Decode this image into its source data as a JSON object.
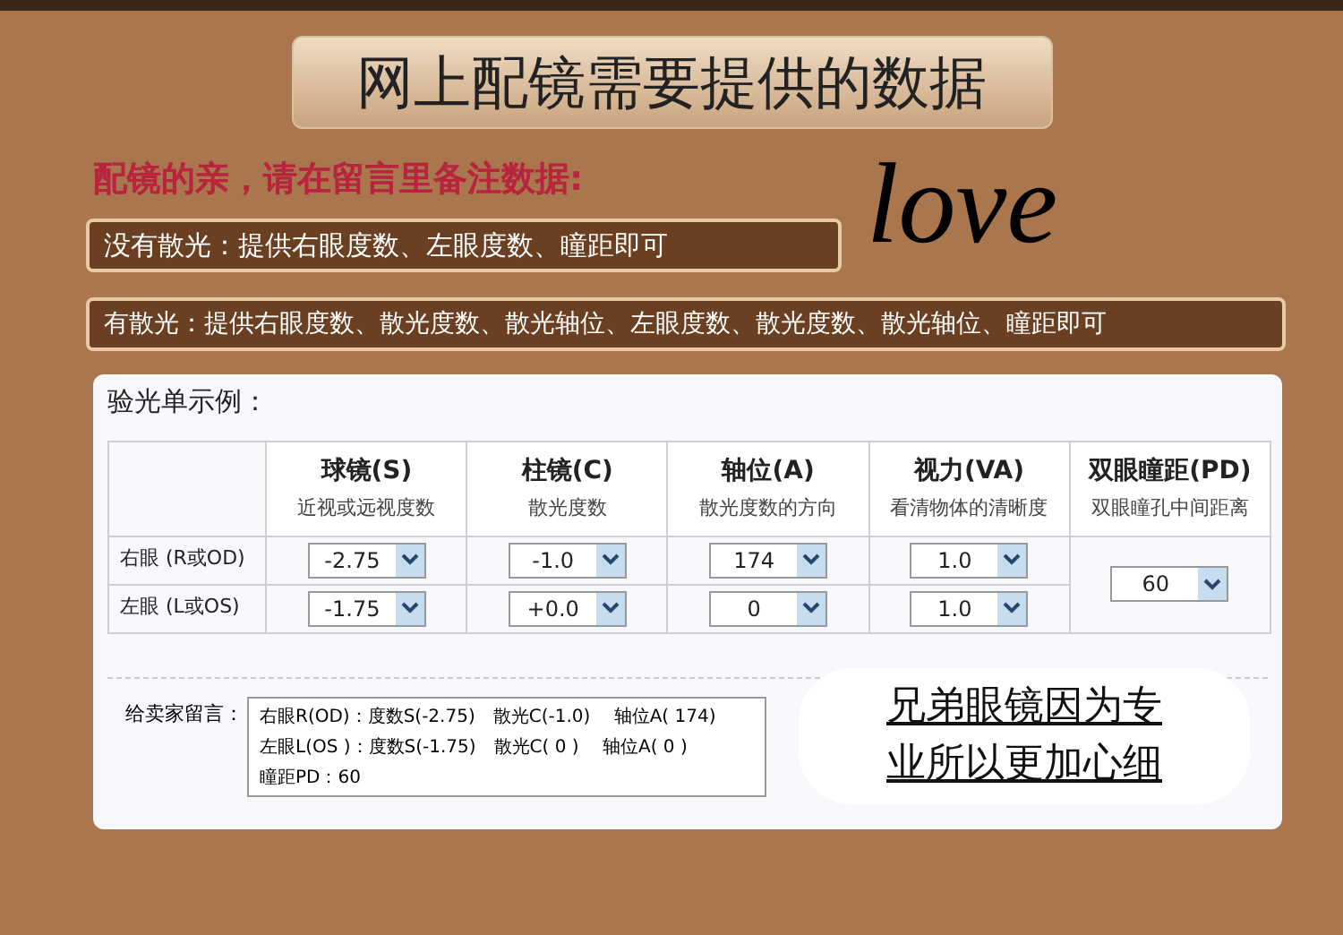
{
  "title": "网上配镜需要提供的数据",
  "subtitle": "配镜的亲，请在留言里备注数据:",
  "notes": [
    "没有散光：提供右眼度数、左眼度数、瞳距即可",
    "有散光：提供右眼度数、散光度数、散光轴位、左眼度数、散光度数、散光轴位、瞳距即可"
  ],
  "signature": "love",
  "form": {
    "heading": "验光单示例：",
    "columns": [
      {
        "name": "球镜(S)",
        "hint": "近视或远视度数"
      },
      {
        "name": "柱镜(C)",
        "hint": "散光度数"
      },
      {
        "name": "轴位(A)",
        "hint": "散光度数的方向"
      },
      {
        "name": "视力(VA)",
        "hint": "看清物体的清晰度"
      },
      {
        "name": "双眼瞳距(PD)",
        "hint": "双眼瞳孔中间距离"
      }
    ],
    "rows": [
      {
        "label": "右眼 (R或OD)",
        "values": [
          "-2.75",
          "-1.0",
          "174",
          "1.0"
        ]
      },
      {
        "label": "左眼 (L或OS)",
        "values": [
          "-1.75",
          "+0.0",
          "0",
          "1.0"
        ]
      }
    ],
    "pd": "60",
    "message_label": "给卖家留言：",
    "message_lines": [
      "右眼R(OD)：度数S(-2.75)　散光C(-1.0)　 轴位A( 174)",
      "左眼L(OS )：度数S(-1.75)　散光C( 0 )　 轴位A( 0 )",
      "瞳距PD：60"
    ],
    "slogan": [
      "兄弟眼镜因为专",
      "业所以更加心细"
    ]
  }
}
